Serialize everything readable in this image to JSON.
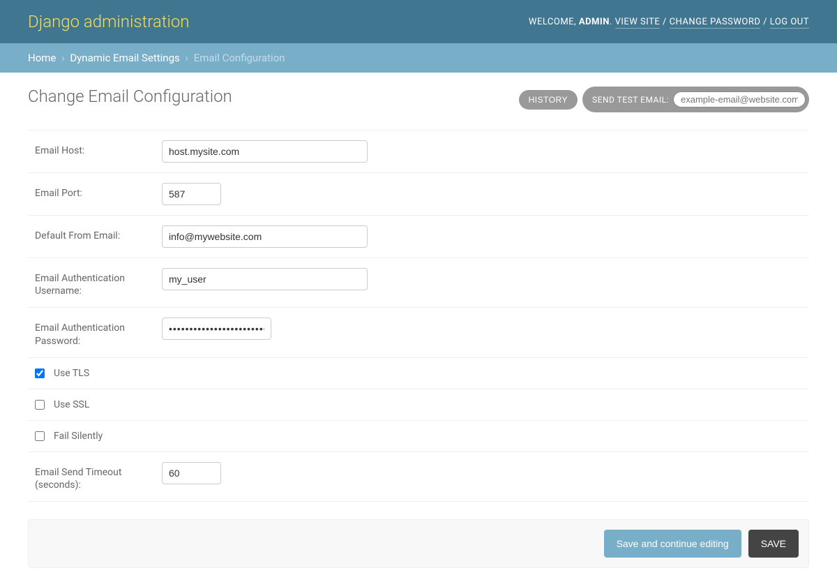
{
  "header": {
    "title": "Django administration",
    "welcome": "WELCOME,",
    "user": "ADMIN",
    "view_site": "VIEW SITE",
    "change_password": "CHANGE PASSWORD",
    "logout": "LOG OUT"
  },
  "breadcrumbs": {
    "home": "Home",
    "app": "Dynamic Email Settings",
    "current": "Email Configuration"
  },
  "page": {
    "title": "Change Email Configuration"
  },
  "tools": {
    "history": "HISTORY",
    "send_test": "SEND TEST EMAIL:",
    "send_test_placeholder": "example-email@website.com"
  },
  "fields": {
    "email_host_label": "Email Host:",
    "email_host_value": "host.mysite.com",
    "email_port_label": "Email Port:",
    "email_port_value": "587",
    "default_from_label": "Default From Email:",
    "default_from_value": "info@mywebsite.com",
    "auth_user_label": "Email Authentication Username:",
    "auth_user_value": "my_user",
    "auth_pw_label": "Email Authentication Password:",
    "auth_pw_value": "••••••••••••••••••••••••••••••",
    "use_tls_label": "Use TLS",
    "use_tls_checked": true,
    "use_ssl_label": "Use SSL",
    "use_ssl_checked": false,
    "fail_silently_label": "Fail Silently",
    "fail_silently_checked": false,
    "timeout_label": "Email Send Timeout (seconds):",
    "timeout_value": "60"
  },
  "submit": {
    "continue": "Save and continue editing",
    "save": "SAVE"
  }
}
